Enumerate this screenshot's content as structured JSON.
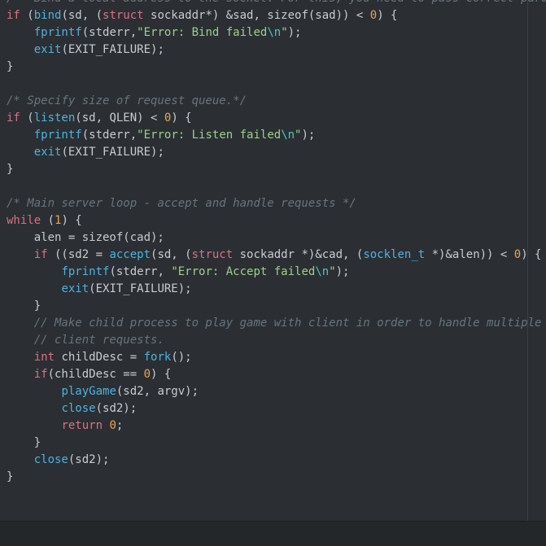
{
  "editor": {
    "lines": [
      [
        [
          "cm",
          "/*  Bind a local address to the socket. For this, you need to pass correct para"
        ]
      ],
      [
        [
          "kw",
          "if"
        ],
        [
          "pl",
          " ("
        ],
        [
          "fn",
          "bind"
        ],
        [
          "pl",
          "(sd, ("
        ],
        [
          "kw",
          "struct"
        ],
        [
          "pl",
          " sockaddr*) &sad, sizeof(sad)) < "
        ],
        [
          "num",
          "0"
        ],
        [
          "pl",
          ") {"
        ]
      ],
      [
        [
          "pl",
          "    "
        ],
        [
          "fn",
          "fprintf"
        ],
        [
          "pl",
          "(stderr,"
        ],
        [
          "str",
          "\"Error: Bind failed"
        ],
        [
          "esc",
          "\\n"
        ],
        [
          "str",
          "\""
        ],
        [
          "pl",
          ");"
        ]
      ],
      [
        [
          "pl",
          "    "
        ],
        [
          "fn",
          "exit"
        ],
        [
          "pl",
          "(EXIT_FAILURE);"
        ]
      ],
      [
        [
          "pl",
          "}"
        ]
      ],
      [],
      [
        [
          "cm",
          "/* Specify size of request queue.*/"
        ]
      ],
      [
        [
          "kw",
          "if"
        ],
        [
          "pl",
          " ("
        ],
        [
          "fn",
          "listen"
        ],
        [
          "pl",
          "(sd, QLEN) < "
        ],
        [
          "num",
          "0"
        ],
        [
          "pl",
          ") {"
        ]
      ],
      [
        [
          "pl",
          "    "
        ],
        [
          "fn",
          "fprintf"
        ],
        [
          "pl",
          "(stderr,"
        ],
        [
          "str",
          "\"Error: Listen failed"
        ],
        [
          "esc",
          "\\n"
        ],
        [
          "str",
          "\""
        ],
        [
          "pl",
          ");"
        ]
      ],
      [
        [
          "pl",
          "    "
        ],
        [
          "fn",
          "exit"
        ],
        [
          "pl",
          "(EXIT_FAILURE);"
        ]
      ],
      [
        [
          "pl",
          "}"
        ]
      ],
      [],
      [
        [
          "cm",
          "/* Main server loop - accept and handle requests */"
        ]
      ],
      [
        [
          "kw",
          "while"
        ],
        [
          "pl",
          " ("
        ],
        [
          "num",
          "1"
        ],
        [
          "pl",
          ") {"
        ]
      ],
      [
        [
          "pl",
          "    alen = sizeof(cad);"
        ]
      ],
      [
        [
          "pl",
          "    "
        ],
        [
          "kw",
          "if"
        ],
        [
          "pl",
          " ((sd2 = "
        ],
        [
          "fn",
          "accept"
        ],
        [
          "pl",
          "(sd, ("
        ],
        [
          "kw",
          "struct"
        ],
        [
          "pl",
          " sockaddr *)&cad, ("
        ],
        [
          "fn",
          "socklen_t"
        ],
        [
          "pl",
          " *)&alen)) < "
        ],
        [
          "num",
          "0"
        ],
        [
          "pl",
          ") {"
        ]
      ],
      [
        [
          "pl",
          "        "
        ],
        [
          "fn",
          "fprintf"
        ],
        [
          "pl",
          "(stderr, "
        ],
        [
          "str",
          "\"Error: Accept failed"
        ],
        [
          "esc",
          "\\n"
        ],
        [
          "str",
          "\""
        ],
        [
          "pl",
          ");"
        ]
      ],
      [
        [
          "pl",
          "        "
        ],
        [
          "fn",
          "exit"
        ],
        [
          "pl",
          "(EXIT_FAILURE);"
        ]
      ],
      [
        [
          "pl",
          "    }"
        ]
      ],
      [
        [
          "pl",
          "    "
        ],
        [
          "cm",
          "// Make child process to play game with client in order to handle multiple"
        ]
      ],
      [
        [
          "pl",
          "    "
        ],
        [
          "cm",
          "// client requests."
        ]
      ],
      [
        [
          "pl",
          "    "
        ],
        [
          "kw",
          "int"
        ],
        [
          "pl",
          " childDesc = "
        ],
        [
          "fn",
          "fork"
        ],
        [
          "pl",
          "();"
        ]
      ],
      [
        [
          "pl",
          "    "
        ],
        [
          "kw",
          "if"
        ],
        [
          "pl",
          "(childDesc == "
        ],
        [
          "num",
          "0"
        ],
        [
          "pl",
          ") {"
        ]
      ],
      [
        [
          "pl",
          "        "
        ],
        [
          "fn",
          "playGame"
        ],
        [
          "pl",
          "(sd2, argv);"
        ]
      ],
      [
        [
          "pl",
          "        "
        ],
        [
          "fn",
          "close"
        ],
        [
          "pl",
          "(sd2);"
        ]
      ],
      [
        [
          "pl",
          "        "
        ],
        [
          "kw",
          "return"
        ],
        [
          "pl",
          " "
        ],
        [
          "num",
          "0"
        ],
        [
          "pl",
          ";"
        ]
      ],
      [
        [
          "pl",
          "    }"
        ]
      ],
      [
        [
          "pl",
          "    "
        ],
        [
          "fn",
          "close"
        ],
        [
          "pl",
          "(sd2);"
        ]
      ],
      [
        [
          "pl",
          "}"
        ]
      ]
    ]
  },
  "theme": {
    "background": "#2b2f33",
    "keyword": "#da6f87",
    "function": "#4bb3e2",
    "string": "#9dd089",
    "number": "#f0a050",
    "comment": "#6a737c"
  }
}
